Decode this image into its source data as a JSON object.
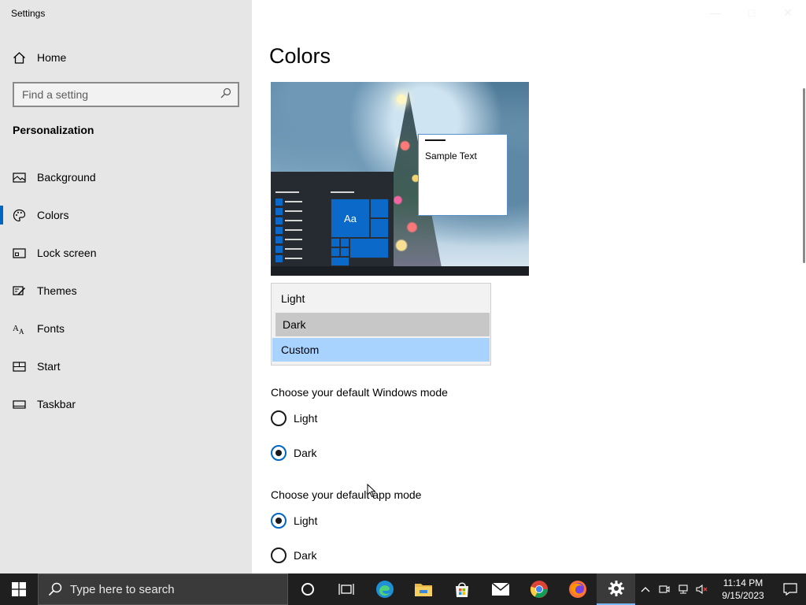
{
  "window": {
    "app_title": "Settings"
  },
  "sidebar": {
    "home_label": "Home",
    "search_placeholder": "Find a setting",
    "section_title": "Personalization",
    "items": [
      {
        "label": "Background",
        "icon": "image-icon"
      },
      {
        "label": "Colors",
        "icon": "palette-icon",
        "active": true
      },
      {
        "label": "Lock screen",
        "icon": "lock-screen-icon"
      },
      {
        "label": "Themes",
        "icon": "brush-icon"
      },
      {
        "label": "Fonts",
        "icon": "font-icon"
      },
      {
        "label": "Start",
        "icon": "start-icon"
      },
      {
        "label": "Taskbar",
        "icon": "taskbar-icon"
      }
    ]
  },
  "main": {
    "title": "Colors",
    "preview": {
      "tile_label": "Aa",
      "sample_text": "Sample Text"
    },
    "color_dropdown": {
      "options": [
        "Light",
        "Dark",
        "Custom"
      ],
      "hovered": "Dark",
      "selected": "Custom"
    },
    "windows_mode": {
      "label": "Choose your default Windows mode",
      "options": [
        {
          "label": "Light",
          "checked": false
        },
        {
          "label": "Dark",
          "checked": true
        }
      ]
    },
    "app_mode": {
      "label": "Choose your default app mode",
      "options": [
        {
          "label": "Light",
          "checked": true
        },
        {
          "label": "Dark",
          "checked": false
        }
      ]
    }
  },
  "taskbar": {
    "search_placeholder": "Type here to search",
    "clock_time": "11:14 PM",
    "clock_date": "9/15/2023"
  },
  "colors": {
    "accent": "#0067c0",
    "dropdown_selected": "#a9d3ff",
    "dropdown_hover": "#c7c7c7",
    "sidebar_bg": "#e6e6e6",
    "taskbar_bg": "#1f1f1f"
  }
}
